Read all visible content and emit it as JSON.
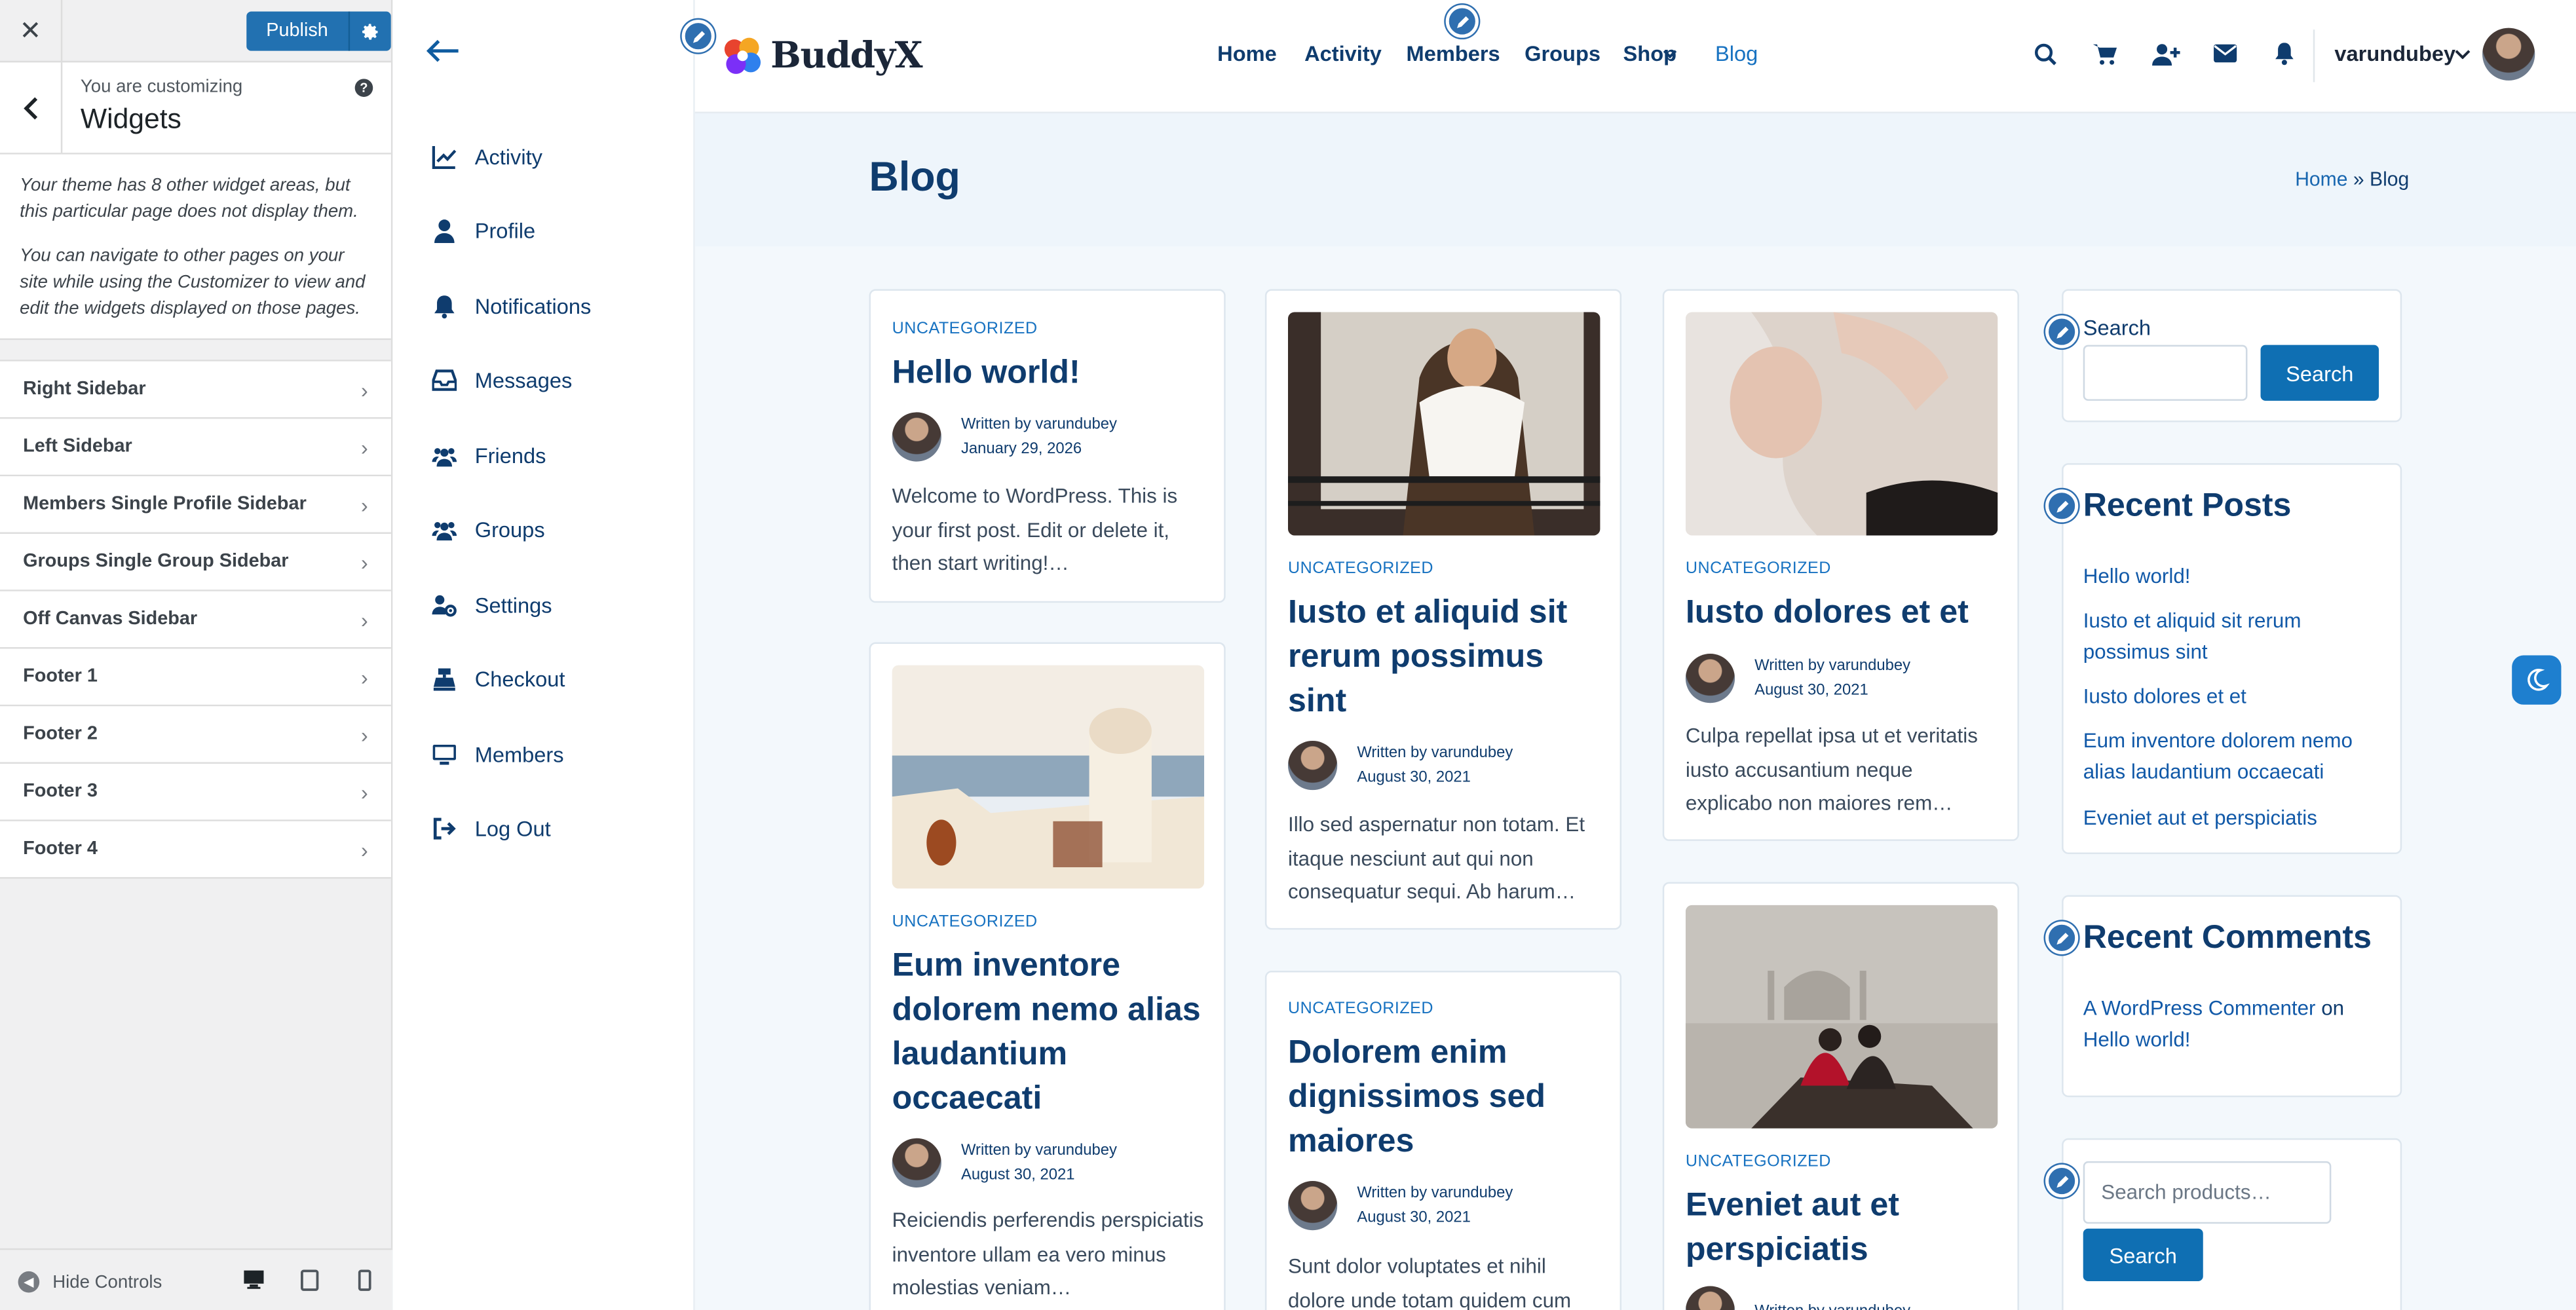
{
  "customizer": {
    "close": "✕",
    "publish_label": "Publish",
    "customizing_label": "You are customizing",
    "section_title": "Widgets",
    "description_1": "Your theme has 8 other widget areas, but this particular page does not display them.",
    "description_2": "You can navigate to other pages on your site while using the Customizer to view and edit the widgets displayed on those pages.",
    "widget_areas": [
      {
        "label": "Right Sidebar"
      },
      {
        "label": "Left Sidebar"
      },
      {
        "label": "Members Single Profile Sidebar"
      },
      {
        "label": "Groups Single Group Sidebar"
      },
      {
        "label": "Off Canvas Sidebar"
      },
      {
        "label": "Footer 1"
      },
      {
        "label": "Footer 2"
      },
      {
        "label": "Footer 3"
      },
      {
        "label": "Footer 4"
      }
    ],
    "hide_controls": "Hide Controls",
    "devices": [
      "desktop-icon",
      "tablet-icon",
      "mobile-icon"
    ]
  },
  "panel_menu": [
    {
      "label": "Activity",
      "icon": "chart-line-icon"
    },
    {
      "label": "Profile",
      "icon": "user-icon"
    },
    {
      "label": "Notifications",
      "icon": "bell-icon"
    },
    {
      "label": "Messages",
      "icon": "inbox-icon"
    },
    {
      "label": "Friends",
      "icon": "friends-icon"
    },
    {
      "label": "Groups",
      "icon": "groups-icon"
    },
    {
      "label": "Settings",
      "icon": "settings-users-icon"
    },
    {
      "label": "Checkout",
      "icon": "cash-register-icon"
    },
    {
      "label": "Members",
      "icon": "desktop-icon"
    },
    {
      "label": "Log Out",
      "icon": "logout-icon"
    }
  ],
  "header": {
    "logo_text": "BuddyX",
    "nav": [
      "Home",
      "Activity",
      "Members",
      "Groups",
      "Shop",
      "Blog"
    ],
    "username": "varundubey"
  },
  "page": {
    "title": "Blog",
    "breadcrumb_home": "Home",
    "breadcrumb_sep": "»",
    "breadcrumb_current": "Blog"
  },
  "posts": [
    {
      "category": "UNCATEGORIZED",
      "title": "Hello world!",
      "author_line": "Written by varundubey",
      "date": "January 29, 2026",
      "excerpt": "Welcome to WordPress. This is your first post. Edit or delete it, then start writing!…"
    },
    {
      "category": "UNCATEGORIZED",
      "title": "Eum inventore dolorem nemo alias laudantium occaecati",
      "author_line": "Written by varundubey",
      "date": "August 30, 2021",
      "excerpt": "Reiciendis perferendis perspiciatis inventore ullam ea vero minus molestias veniam…"
    },
    {
      "category": "UNCATEGORIZED",
      "title": "Iusto et aliquid sit rerum possimus sint",
      "author_line": "Written by varundubey",
      "date": "August 30, 2021",
      "excerpt": "Illo sed aspernatur non totam. Et itaque nesciunt aut qui non consequatur sequi. Ab harum…"
    },
    {
      "category": "UNCATEGORIZED",
      "title": "Dolorem enim dignissimos sed maiores",
      "author_line": "Written by varundubey",
      "date": "August 30, 2021",
      "excerpt": "Sunt dolor voluptates et nihil dolore unde totam quidem cum"
    },
    {
      "category": "UNCATEGORIZED",
      "title": "Iusto dolores et et",
      "author_line": "Written by varundubey",
      "date": "August 30, 2021",
      "excerpt": "Culpa repellat ipsa ut et veritatis iusto accusantium neque explicabo non maiores rem…"
    },
    {
      "category": "UNCATEGORIZED",
      "title": "Eveniet aut et perspiciatis",
      "author_line": "Written by varundubey",
      "date": ""
    }
  ],
  "sidebar": {
    "search_label": "Search",
    "search_button": "Search",
    "recent_posts_title": "Recent Posts",
    "recent_posts": [
      "Hello world!",
      "Iusto et aliquid sit rerum possimus sint",
      "Iusto dolores et et",
      "Eum inventore dolorem nemo alias laudantium occaecati",
      "Eveniet aut et perspiciatis"
    ],
    "recent_comments_title": "Recent Comments",
    "comment_author": "A WordPress Commenter",
    "comment_on": "on",
    "comment_post": "Hello world!",
    "product_search_placeholder": "Search products…",
    "product_search_button": "Search"
  },
  "colors": {
    "brand": "#0f3c6e",
    "accent": "#0f6fb3",
    "customizer_bg": "#f0f0f1"
  }
}
